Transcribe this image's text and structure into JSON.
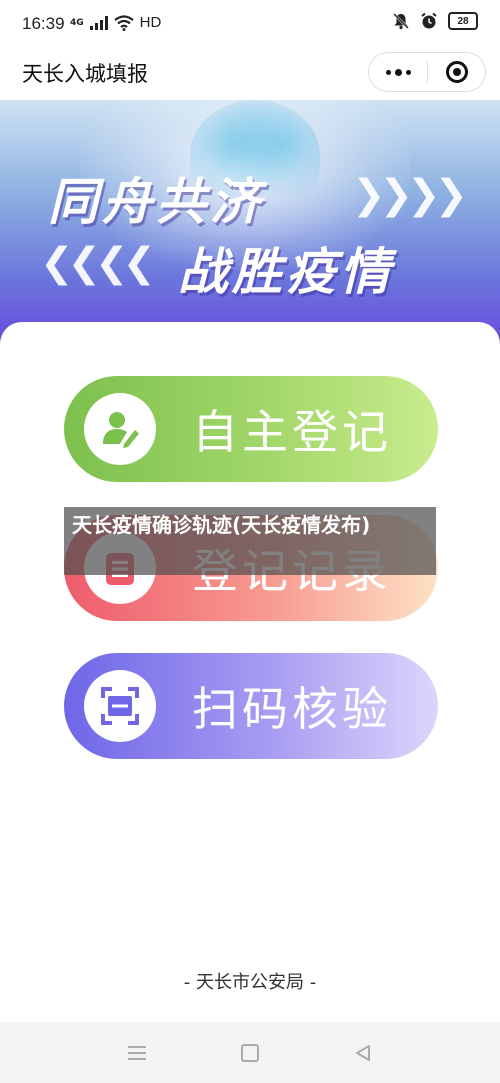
{
  "status_bar": {
    "time": "16:39",
    "network": "4G",
    "wifi_label": "HD",
    "battery": "28",
    "icons": [
      "signal-icon",
      "wifi-icon",
      "mute-icon",
      "alarm-icon",
      "battery-icon"
    ]
  },
  "header": {
    "title": "天长入城填报",
    "icons": [
      "more-icon",
      "close-miniprogram-icon"
    ]
  },
  "banner": {
    "line1": "同舟共济",
    "line2": "战胜疫情",
    "chevrons_right": "❯❯❯❯",
    "chevrons_left": "❮❮❮❮"
  },
  "actions": [
    {
      "label": "自主登记",
      "icon": "user-edit-icon",
      "color": "#7cc04d"
    },
    {
      "label": "登记记录",
      "icon": "record-list-icon",
      "color": "#ee5c6c"
    },
    {
      "label": "扫码核验",
      "icon": "scan-icon",
      "color": "#6f66e8"
    }
  ],
  "overlay": {
    "text": "天长疫情确诊轨迹(天长疫情发布)"
  },
  "footer": {
    "credit": "- 天长市公安局 -"
  },
  "nav": {
    "icons": [
      "menu-icon",
      "home-icon",
      "back-icon"
    ]
  }
}
